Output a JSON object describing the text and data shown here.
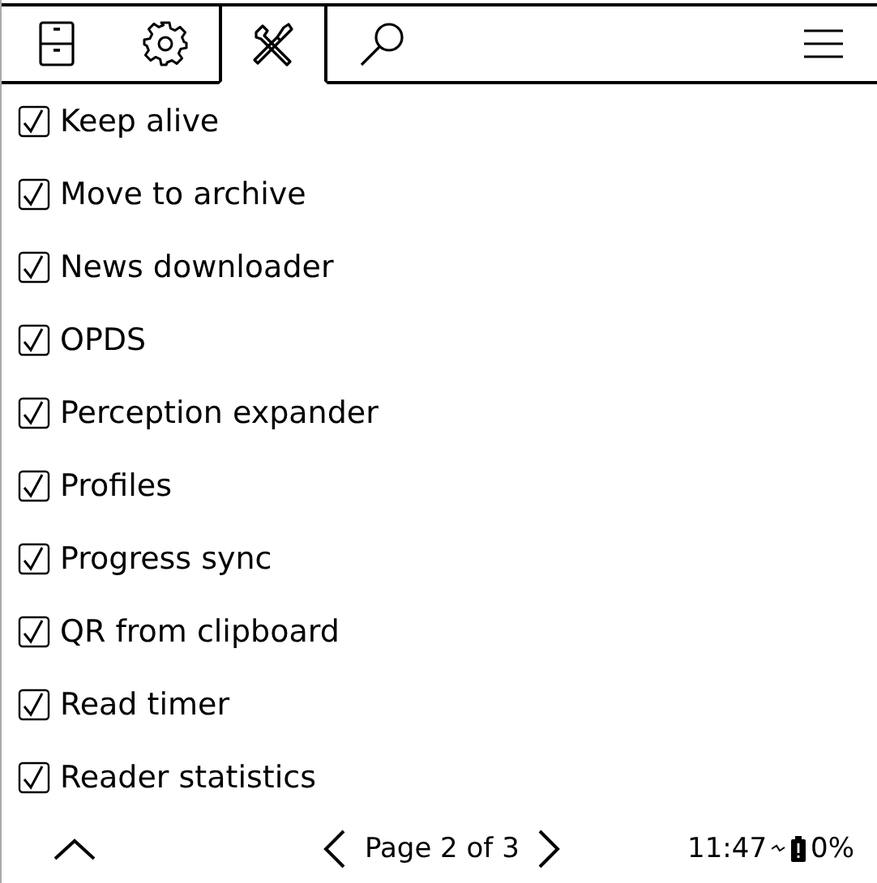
{
  "tabs": [
    {
      "kind": "cabinet",
      "selected": false
    },
    {
      "kind": "gear",
      "selected": false
    },
    {
      "kind": "tools",
      "selected": true
    },
    {
      "kind": "search",
      "selected": false
    }
  ],
  "items": [
    {
      "label": "Keep alive",
      "checked": true
    },
    {
      "label": "Move to archive",
      "checked": true
    },
    {
      "label": "News downloader",
      "checked": true
    },
    {
      "label": "OPDS",
      "checked": true
    },
    {
      "label": "Perception expander",
      "checked": true
    },
    {
      "label": "Profiles",
      "checked": true
    },
    {
      "label": "Progress sync",
      "checked": true
    },
    {
      "label": "QR from clipboard",
      "checked": true
    },
    {
      "label": "Read timer",
      "checked": true
    },
    {
      "label": "Reader statistics",
      "checked": true
    }
  ],
  "footer": {
    "page": "Page 2 of 3",
    "time": "11:47",
    "battery": "0%"
  }
}
